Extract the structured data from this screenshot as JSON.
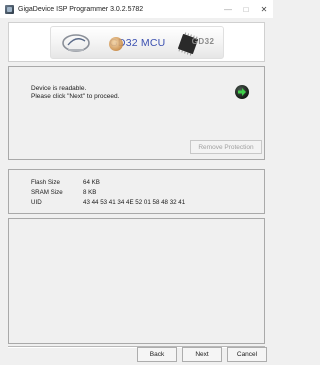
{
  "window": {
    "title": "GigaDevice ISP Programmer 3.0.2.5782",
    "minimize_glyph": "—",
    "maximize_glyph": "□",
    "close_glyph": "✕"
  },
  "banner": {
    "brand_text": "GD32 MCU",
    "gd32_tag": "GD32"
  },
  "status": {
    "line1": "Device is readable.",
    "line2": "Please click \"Next\" to proceed.",
    "remove_protection_label": "Remove Protection"
  },
  "device_info": {
    "rows": [
      {
        "label": "Flash Size",
        "value": "64 KB"
      },
      {
        "label": "SRAM Size",
        "value": "8 KB"
      },
      {
        "label": "UID",
        "value": "43 44 53 41 34 4E 52 01 58 48 32 41"
      }
    ]
  },
  "footer": {
    "back_label": "Back",
    "next_label": "Next",
    "cancel_label": "Cancel"
  },
  "icons": {
    "app": "app-icon",
    "next_arrow": "next-arrow-icon",
    "logo": "gigadevice-logo",
    "chip": "chip-icon"
  },
  "colors": {
    "brand_blue": "#3a4fb0",
    "arrow_green": "#3fd04a",
    "disabled_text": "#a0a0a0"
  }
}
